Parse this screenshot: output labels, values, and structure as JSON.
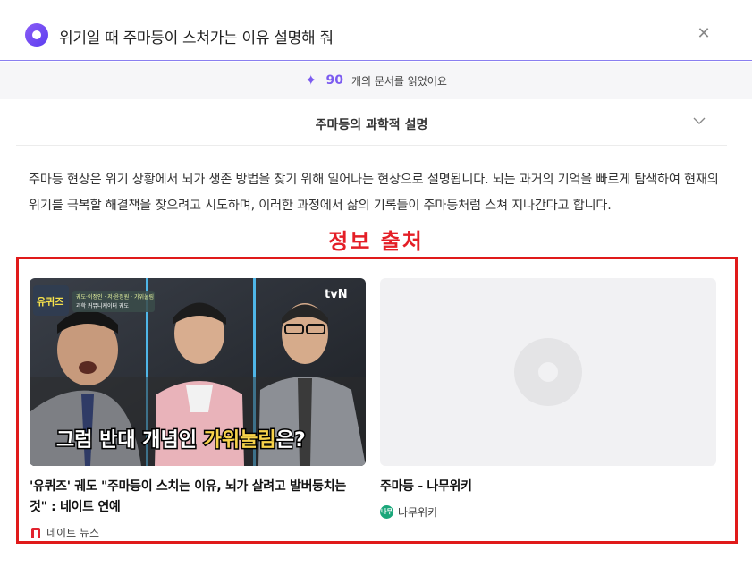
{
  "header": {
    "title": "위기일 때 주마등이 스쳐가는 이유 설명해 줘",
    "logo_icon": "circle-logo-icon",
    "close_icon": "close-icon",
    "close_glyph": "✕"
  },
  "documents": {
    "icon": "sparkle-icon",
    "count": "90",
    "label": "개의 문서를 읽었어요"
  },
  "section": {
    "title": "주마등의 과학적 설명",
    "icon": "chevron-down-icon"
  },
  "body": {
    "text": "주마등 현상은 위기 상황에서 뇌가 생존 방법을 찾기 위해 일어나는 현상으로 설명됩니다. 뇌는 과거의 기억을 빠르게 탐색하여 현재의 위기를 극복할 해결책을 찾으려고 시도하며, 이러한 과정에서 삶의 기록들이 주마등처럼 스쳐 지나간다고 합니다."
  },
  "annotation": {
    "label": "정보 출처",
    "color": "#e41e26"
  },
  "sources": [
    {
      "title": "'유퀴즈' 궤도 \"주마등이 스치는 이유, 뇌가 살려고 발버둥치는 것\" : 네이트 연예",
      "source_name": "네이트 뉴스",
      "source_icon": "nate-logo-icon",
      "thumbnail": {
        "channel": "tvN",
        "badge": "유퀴즈",
        "caption_line1": "궤도·이정인 · 저·윤정원 · 가위눌림",
        "caption_line2": "과학 커뮤니케이터 궤도",
        "subtitle_prefix": "그럼 반대 개념인 ",
        "subtitle_highlight": "가위눌림",
        "subtitle_suffix": "은?"
      }
    },
    {
      "title": "주마등 - 나무위키",
      "source_name": "나무위키",
      "source_icon": "namuwiki-logo-icon",
      "source_icon_text": "나무",
      "thumbnail": {
        "placeholder_icon": "image-placeholder-icon"
      }
    }
  ],
  "colors": {
    "accent": "#7c5cf0",
    "highlight_box": "#e01a1a",
    "nate": "#e2232e",
    "namu": "#1aa77a"
  }
}
